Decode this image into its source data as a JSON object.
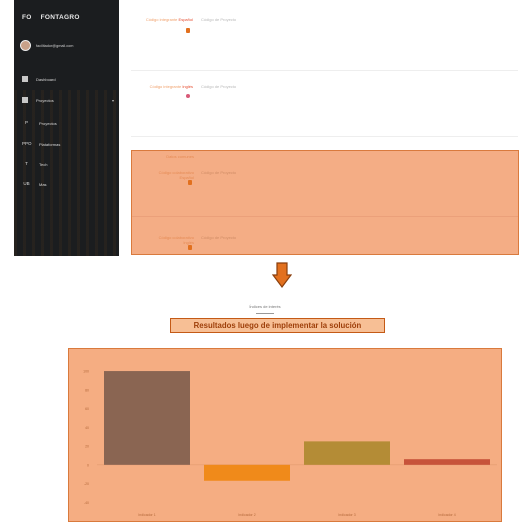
{
  "sidebar": {
    "brand_initials": "FO",
    "brand_name": "FONTAGRO",
    "user_email": "facilitador@gmail.com",
    "items": [
      {
        "label": "Dashboard",
        "icon": "grid-icon"
      },
      {
        "label": "Proyectos",
        "icon": "folder-icon"
      },
      {
        "label": "Proyectos",
        "icon": "p-icon"
      },
      {
        "label": "Plataformas",
        "icon": "ppo-icon"
      },
      {
        "label": "Tech",
        "icon": "t-icon"
      },
      {
        "label": "Mas",
        "icon": "ub-icon"
      }
    ]
  },
  "form": {
    "field1": {
      "label": "Código integrante",
      "required": "Español",
      "placeholder": "Código de Proyecto"
    },
    "field2": {
      "label": "Código integrante",
      "required": "Inglés",
      "placeholder": "Código de Proyecto"
    },
    "field3": {
      "label": "Datos comunes"
    },
    "field4": {
      "label": "Código colaborativo",
      "required": "Español",
      "placeholder": "Código de Proyecto"
    },
    "field5": {
      "label": "Código colaborativo",
      "required": "Inglés",
      "placeholder": "Código de Proyecto"
    }
  },
  "caption": {
    "small": "Índices de interés",
    "banner": "Resultados luego de implementar la solución"
  },
  "colors": {
    "highlight": "#f4ad85",
    "arrow": "#e2701e",
    "bar1": "#8a6552",
    "bar2": "#f08a1a",
    "bar3": "#b48c36",
    "bar4": "#c7533a"
  },
  "chart_data": {
    "type": "bar",
    "categories": [
      "Indicador 1",
      "Indicador 2",
      "Indicador 3",
      "Indicador 4"
    ],
    "values": [
      100,
      -17,
      25,
      6
    ],
    "ylim": [
      -45,
      115
    ],
    "yticks": [
      -40,
      -20,
      0,
      20,
      40,
      60,
      80,
      100
    ],
    "ylabel": ""
  }
}
